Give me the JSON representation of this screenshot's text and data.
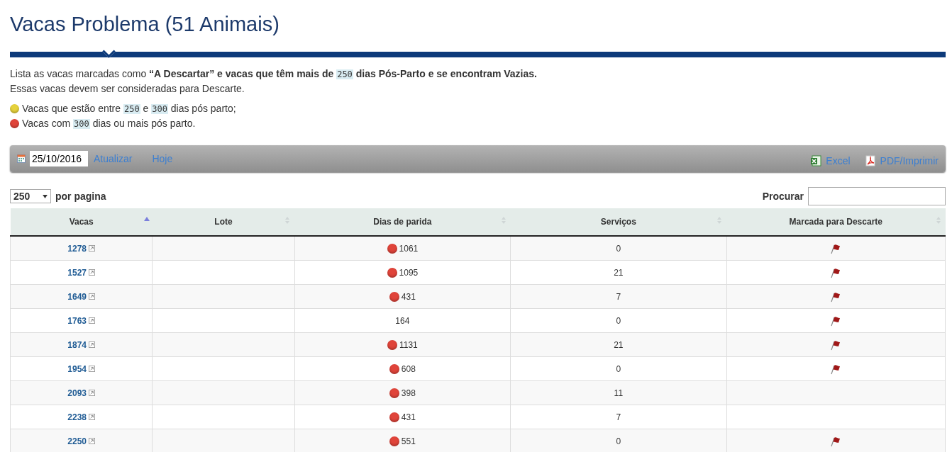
{
  "title": "Vacas Problema (51 Animais)",
  "intro": [
    [
      {
        "kind": "plain",
        "text": "Lista as vacas marcadas como "
      },
      {
        "kind": "bold",
        "text": "“A Descartar” e vacas que têm mais de "
      },
      {
        "kind": "number",
        "text": "250"
      },
      {
        "kind": "bold",
        "text": " dias Pós-Parto e se encontram Vazias."
      }
    ],
    [
      {
        "kind": "plain",
        "text": "Essas vacas devem ser consideradas para Descarte."
      }
    ]
  ],
  "legend": [
    {
      "color": "#e6d23c",
      "parts": [
        {
          "kind": "plain",
          "text": "Vacas que estão entre "
        },
        {
          "kind": "number",
          "text": "250"
        },
        {
          "kind": "plain",
          "text": " e "
        },
        {
          "kind": "number",
          "text": "300"
        },
        {
          "kind": "plain",
          "text": " dias pós parto;"
        }
      ]
    },
    {
      "color": "#e0443a",
      "parts": [
        {
          "kind": "plain",
          "text": "Vacas com "
        },
        {
          "kind": "number",
          "text": "300"
        },
        {
          "kind": "plain",
          "text": " dias ou mais pós parto."
        }
      ]
    }
  ],
  "toolbar": {
    "date": "25/10/2016",
    "links": [
      "Atualizar",
      "Hoje"
    ],
    "exports": [
      {
        "kind": "excel",
        "label": "Excel"
      },
      {
        "kind": "pdf",
        "label": "PDF/Imprimir"
      }
    ]
  },
  "page_size": {
    "value": "250",
    "label": "por pagina"
  },
  "search": {
    "label": "Procurar"
  },
  "table": {
    "columns": [
      {
        "label": "Vacas",
        "sorted": true
      },
      {
        "label": "Lote",
        "sorted": false
      },
      {
        "label": "Dias de parida",
        "sorted": false
      },
      {
        "label": "Serviços",
        "sorted": false
      },
      {
        "label": "Marcada para Descarte",
        "sorted": false
      }
    ],
    "rows": [
      {
        "vaca": "1278",
        "color": "#e0443a",
        "dias": "1061",
        "servicos": "0",
        "marked": true
      },
      {
        "vaca": "1527",
        "color": "#e0443a",
        "dias": "1095",
        "servicos": "21",
        "marked": true
      },
      {
        "vaca": "1649",
        "color": "#e0443a",
        "dias": "431",
        "servicos": "7",
        "marked": true
      },
      {
        "vaca": "1763",
        "dias": "164",
        "servicos": "0",
        "marked": true
      },
      {
        "vaca": "1874",
        "color": "#e0443a",
        "dias": "1131",
        "servicos": "21",
        "marked": true
      },
      {
        "vaca": "1954",
        "color": "#e0443a",
        "dias": "608",
        "servicos": "0",
        "marked": true
      },
      {
        "vaca": "2093",
        "color": "#e0443a",
        "dias": "398",
        "servicos": "11",
        "marked": false
      },
      {
        "vaca": "2238",
        "color": "#e0443a",
        "dias": "431",
        "servicos": "7",
        "marked": false
      },
      {
        "vaca": "2250",
        "color": "#e0443a",
        "dias": "551",
        "servicos": "0",
        "marked": true
      }
    ]
  }
}
